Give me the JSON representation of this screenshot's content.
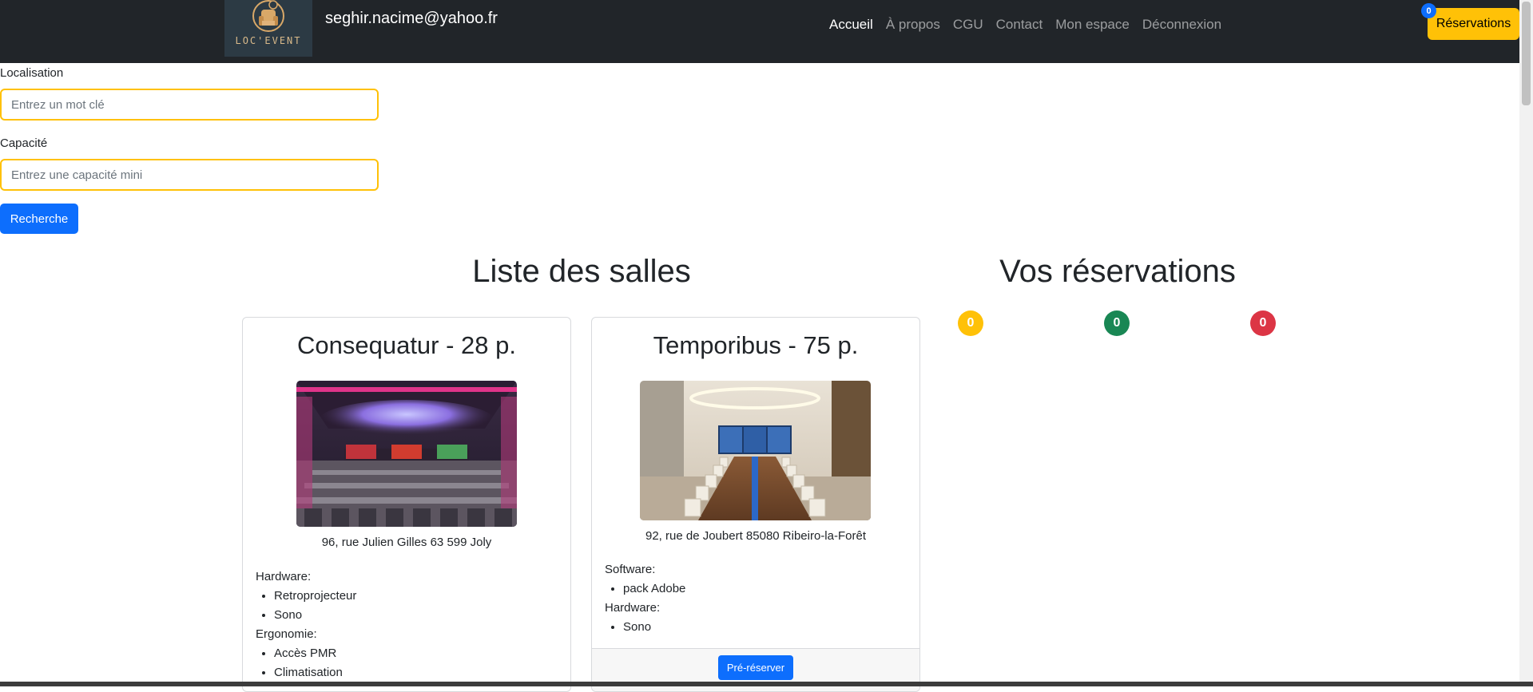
{
  "navbar": {
    "logo_text": "LOC'EVENT",
    "user_email": "seghir.nacime@yahoo.fr",
    "links": [
      "Accueil",
      "À propos",
      "CGU",
      "Contact",
      "Mon espace",
      "Déconnexion"
    ],
    "active_link": "Accueil",
    "reservations_label": "Réservations",
    "reservations_count": "0"
  },
  "search": {
    "location_label": "Localisation",
    "location_placeholder": "Entrez un mot clé",
    "capacity_label": "Capacité",
    "capacity_placeholder": "Entrez une capacité mini",
    "submit_label": "Recherche"
  },
  "rooms": {
    "title": "Liste des salles",
    "items": [
      {
        "title": "Consequatur - 28 p.",
        "address": "96, rue Julien Gilles 63 599 Joly",
        "groups": [
          {
            "label": "Hardware:",
            "items": [
              "Retroprojecteur",
              "Sono"
            ]
          },
          {
            "label": "Ergonomie:",
            "items": [
              "Accès PMR",
              "Climatisation"
            ]
          }
        ]
      },
      {
        "title": "Temporibus - 75 p.",
        "address": "92, rue de Joubert 85080 Ribeiro-la-Forêt",
        "groups": [
          {
            "label": "Software:",
            "items": [
              "pack Adobe"
            ]
          },
          {
            "label": "Hardware:",
            "items": [
              "Sono"
            ]
          }
        ],
        "action_label": "Pré-réserver"
      }
    ]
  },
  "reservations": {
    "title": "Vos réservations",
    "statuses": [
      {
        "count": "0",
        "color": "#ffc107"
      },
      {
        "count": "0",
        "color": "#198754"
      },
      {
        "count": "0",
        "color": "#dc3545"
      }
    ]
  },
  "colors": {
    "navbar": "#212529",
    "primary": "#0d6efd",
    "warning": "#ffc107",
    "success": "#198754",
    "danger": "#dc3545"
  }
}
